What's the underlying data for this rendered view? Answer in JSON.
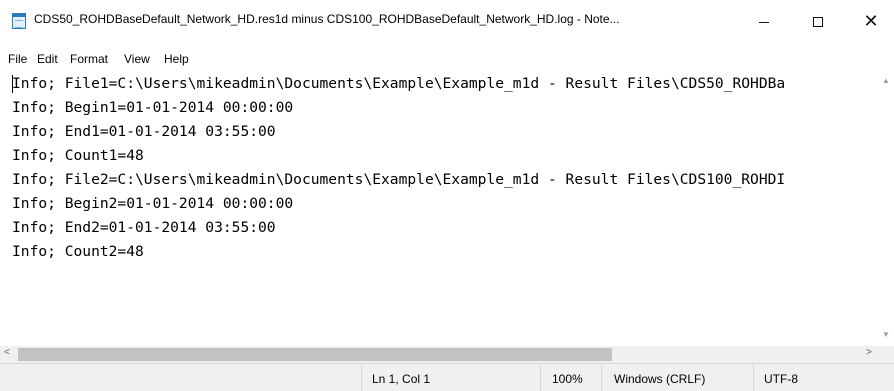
{
  "window": {
    "title": "CDS50_ROHDBaseDefault_Network_HD.res1d minus CDS100_ROHDBaseDefault_Network_HD.log - Note...",
    "app_icon": "notepad-icon",
    "controls": {
      "minimize": "minimize-icon",
      "maximize": "maximize-icon",
      "close_label": "✕"
    }
  },
  "menu": {
    "file": "File",
    "edit": "Edit",
    "format": "Format",
    "view": "View",
    "help": "Help"
  },
  "editor": {
    "lines": [
      "Info; File1=C:\\Users\\mikeadmin\\Documents\\Example\\Example_m1d - Result Files\\CDS50_ROHDBa",
      "Info; Begin1=01-01-2014 00:00:00",
      "Info; End1=01-01-2014 03:55:00",
      "Info; Count1=48",
      "Info; File2=C:\\Users\\mikeadmin\\Documents\\Example\\Example_m1d - Result Files\\CDS100_ROHDI",
      "Info; Begin2=01-01-2014 00:00:00",
      "Info; End2=01-01-2014 03:55:00",
      "Info; Count2=48"
    ]
  },
  "scrollbars": {
    "left_arrow": "<",
    "right_arrow": ">",
    "up_arrow": "▲",
    "down_arrow": "▼"
  },
  "status": {
    "position": "Ln 1, Col 1",
    "zoom": "100%",
    "line_endings": "Windows (CRLF)",
    "encoding": "UTF-8"
  }
}
